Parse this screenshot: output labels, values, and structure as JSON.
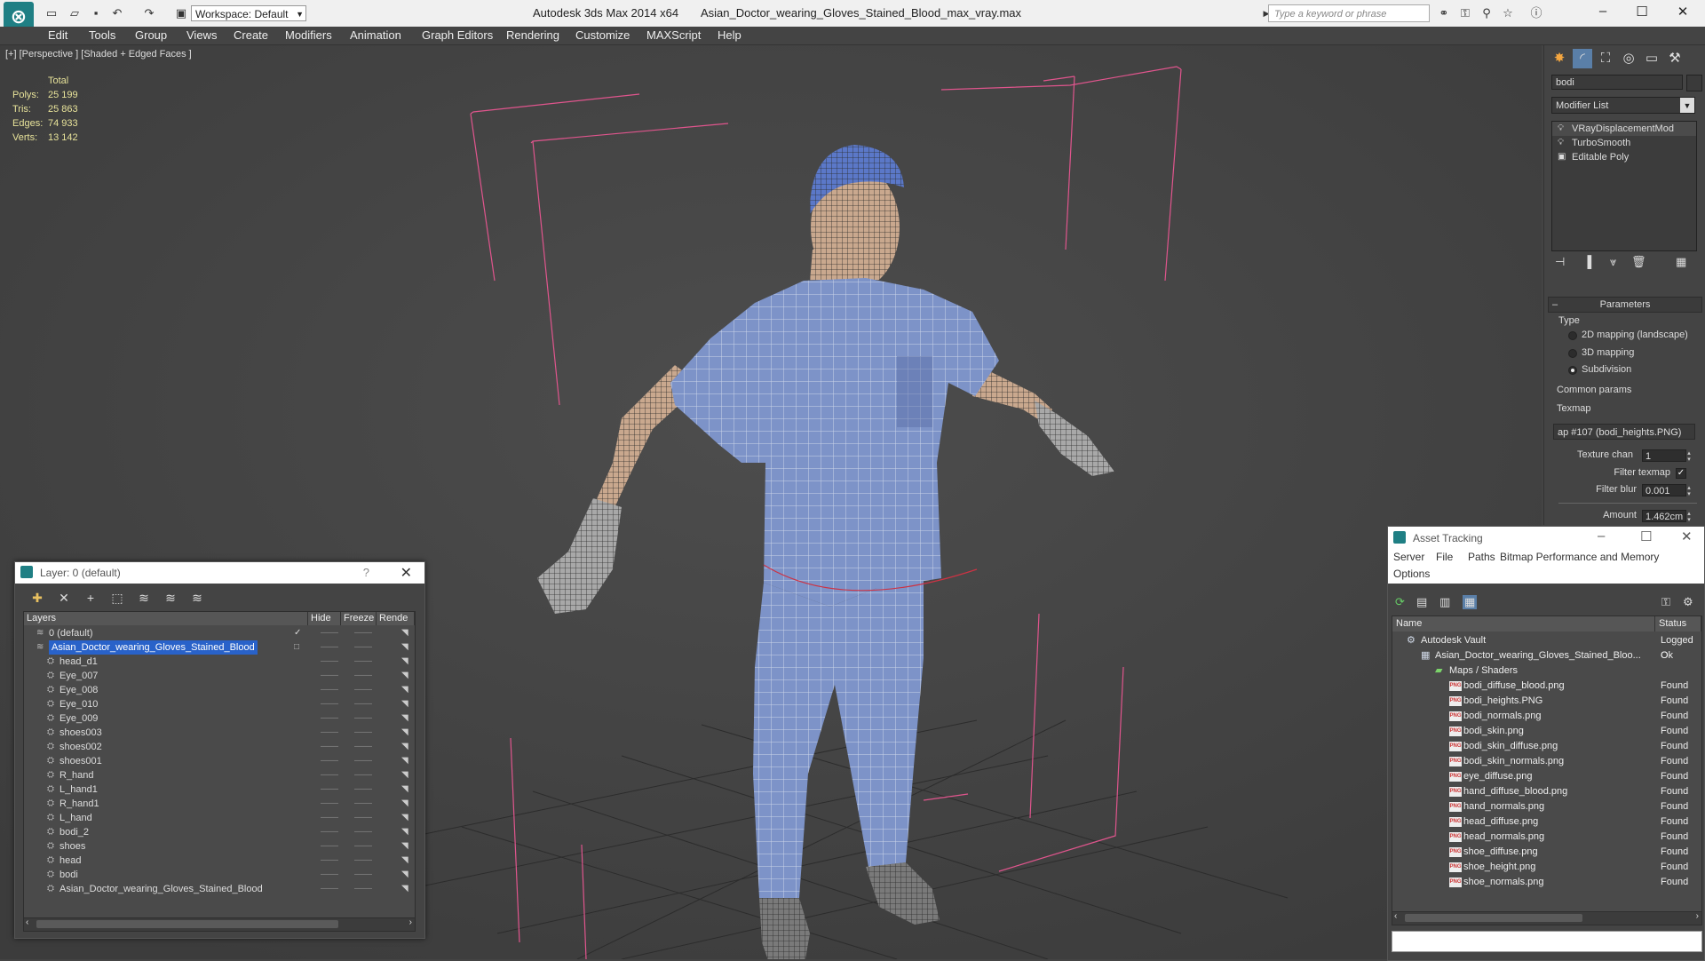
{
  "app": {
    "title": "Autodesk 3ds Max  2014 x64",
    "file": "Asian_Doctor_wearing_Gloves_Stained_Blood_max_vray.max",
    "logo": "3ds-max-logo",
    "workspace": "Workspace: Default",
    "search_placeholder": "Type a keyword or phrase"
  },
  "menu": [
    "Edit",
    "Tools",
    "Group",
    "Views",
    "Create",
    "Modifiers",
    "Animation",
    "Graph Editors",
    "Rendering",
    "Customize",
    "MAXScript",
    "Help"
  ],
  "viewport": {
    "label": "[+] [Perspective ] [Shaded + Edged Faces ]",
    "stats": {
      "header": "Total",
      "rows": [
        {
          "label": "Polys:",
          "value": "25 199"
        },
        {
          "label": "Tris:",
          "value": "25 863"
        },
        {
          "label": "Edges:",
          "value": "74 933"
        },
        {
          "label": "Verts:",
          "value": "13 142"
        }
      ]
    }
  },
  "command_panel": {
    "object_name": "bodi",
    "modifier_list": "Modifier List",
    "stack": [
      "VRayDisplacementMod",
      "TurboSmooth",
      "Editable Poly"
    ],
    "rollout_title": "Parameters",
    "type_label": "Type",
    "type_options": [
      "2D mapping (landscape)",
      "3D mapping",
      "Subdivision"
    ],
    "type_selected": "Subdivision",
    "common_params_label": "Common params",
    "texmap_label": "Texmap",
    "texmap_value": "ap #107 (bodi_heights.PNG)",
    "texture_chan_label": "Texture chan",
    "texture_chan_value": "1",
    "filter_texmap_label": "Filter texmap",
    "filter_texmap_checked": "✓",
    "filter_blur_label": "Filter blur",
    "filter_blur_value": "0.001",
    "amount_label": "Amount",
    "amount_value": "1.462cm"
  },
  "layer_dialog": {
    "title": "Layer: 0 (default)",
    "help": "?",
    "columns": [
      "Layers",
      "Hide",
      "Freeze",
      "Rende"
    ],
    "rows": [
      {
        "name": "0 (default)",
        "level": 0,
        "check": "✓"
      },
      {
        "name": "Asian_Doctor_wearing_Gloves_Stained_Blood",
        "level": 0,
        "selected": true
      },
      {
        "name": "head_d1",
        "level": 1
      },
      {
        "name": "Eye_007",
        "level": 1
      },
      {
        "name": "Eye_008",
        "level": 1
      },
      {
        "name": "Eye_010",
        "level": 1
      },
      {
        "name": "Eye_009",
        "level": 1
      },
      {
        "name": "shoes003",
        "level": 1
      },
      {
        "name": "shoes002",
        "level": 1
      },
      {
        "name": "shoes001",
        "level": 1
      },
      {
        "name": "R_hand",
        "level": 1
      },
      {
        "name": "L_hand1",
        "level": 1
      },
      {
        "name": "R_hand1",
        "level": 1
      },
      {
        "name": "L_hand",
        "level": 1
      },
      {
        "name": "bodi_2",
        "level": 1
      },
      {
        "name": "shoes",
        "level": 1
      },
      {
        "name": "head",
        "level": 1
      },
      {
        "name": "bodi",
        "level": 1
      },
      {
        "name": "Asian_Doctor_wearing_Gloves_Stained_Blood",
        "level": 1
      }
    ]
  },
  "asset_tracking": {
    "title": "Asset Tracking",
    "menu": [
      "Server",
      "File",
      "Paths",
      "Bitmap Performance and Memory",
      "Options"
    ],
    "columns": [
      "Name",
      "Status"
    ],
    "rows": [
      {
        "name": "Autodesk Vault",
        "status": "Logged O",
        "level": 0,
        "kind": "vault"
      },
      {
        "name": "Asian_Doctor_wearing_Gloves_Stained_Bloo...",
        "status": "Ok",
        "level": 1,
        "kind": "file"
      },
      {
        "name": "Maps / Shaders",
        "status": "",
        "level": 2,
        "kind": "folder"
      },
      {
        "name": "bodi_diffuse_blood.png",
        "status": "Found",
        "level": 3,
        "kind": "png"
      },
      {
        "name": "bodi_heights.PNG",
        "status": "Found",
        "level": 3,
        "kind": "png"
      },
      {
        "name": "bodi_normals.png",
        "status": "Found",
        "level": 3,
        "kind": "png"
      },
      {
        "name": "bodi_skin.png",
        "status": "Found",
        "level": 3,
        "kind": "png"
      },
      {
        "name": "bodi_skin_diffuse.png",
        "status": "Found",
        "level": 3,
        "kind": "png"
      },
      {
        "name": "bodi_skin_normals.png",
        "status": "Found",
        "level": 3,
        "kind": "png"
      },
      {
        "name": "eye_diffuse.png",
        "status": "Found",
        "level": 3,
        "kind": "png"
      },
      {
        "name": "hand_diffuse_blood.png",
        "status": "Found",
        "level": 3,
        "kind": "png"
      },
      {
        "name": "hand_normals.png",
        "status": "Found",
        "level": 3,
        "kind": "png"
      },
      {
        "name": "head_diffuse.png",
        "status": "Found",
        "level": 3,
        "kind": "png"
      },
      {
        "name": "head_normals.png",
        "status": "Found",
        "level": 3,
        "kind": "png"
      },
      {
        "name": "shoe_diffuse.png",
        "status": "Found",
        "level": 3,
        "kind": "png"
      },
      {
        "name": "shoe_height.png",
        "status": "Found",
        "level": 3,
        "kind": "png"
      },
      {
        "name": "shoe_normals.png",
        "status": "Found",
        "level": 3,
        "kind": "png"
      }
    ]
  },
  "colors": {
    "scrubs": "#7d93c8",
    "skin": "#c9a88e",
    "glove": "#a8a8a8",
    "bounding_box": "#e0558d",
    "selection": "#2962c9"
  }
}
